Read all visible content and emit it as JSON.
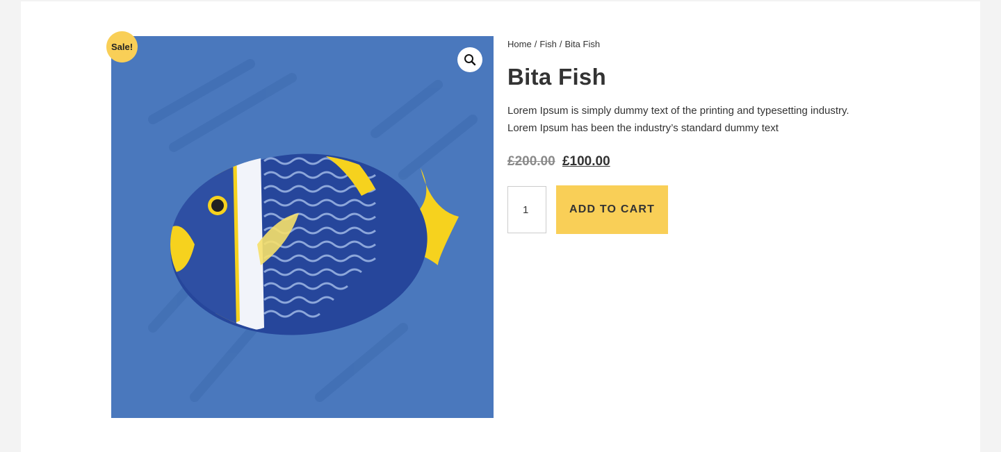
{
  "product": {
    "sale_badge": "Sale!",
    "title": "Bita Fish",
    "description_line1": "Lorem Ipsum is simply dummy text of the printing and typesetting industry.",
    "description_line2": "Lorem Ipsum has been the industry’s standard dummy text",
    "old_price": "£200.00",
    "new_price": "£100.00",
    "quantity": "1",
    "add_to_cart_label": "ADD TO CART",
    "image_subject": "yellow-and-blue striped tropical fish",
    "zoom_icon": "magnifier-icon"
  },
  "breadcrumb": {
    "home": "Home",
    "separator": "/",
    "category": "Fish",
    "current": "Bita Fish"
  },
  "colors": {
    "page_background": "#f3f3f3",
    "image_background": "#4a78bd",
    "accent_yellow": "#f9cf57",
    "text": "#333333",
    "old_price": "#8a8a8a"
  }
}
